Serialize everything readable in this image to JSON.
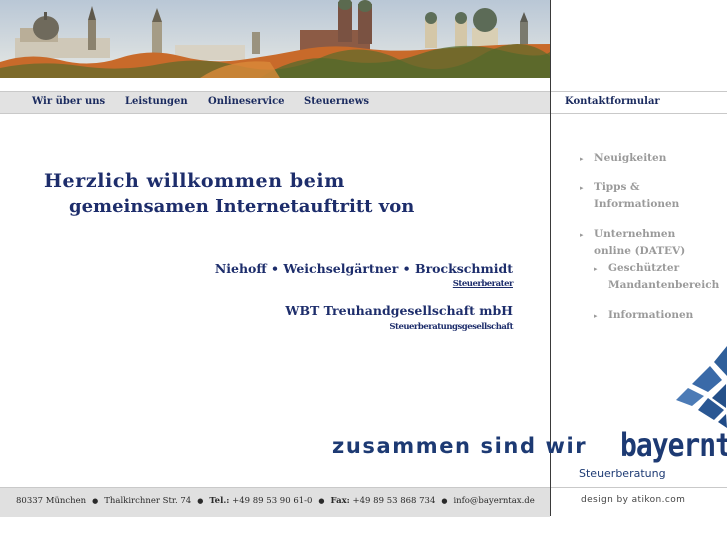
{
  "nav": {
    "items": [
      "Wir über uns",
      "Leistungen",
      "Onlineservice",
      "Steuernews"
    ],
    "contact": "Kontaktformular"
  },
  "welcome": {
    "line1": "Herzlich willkommen beim",
    "line2": "gemeinsamen Internetauftritt von"
  },
  "firms": [
    {
      "name": "Niehoff • Weichselgärtner • Brockschmidt",
      "type": "Steuerberater"
    },
    {
      "name": "WBT Treuhandgesellschaft mbH",
      "type": "Steuerberatungsgesellschaft"
    }
  ],
  "sidebar": {
    "bullet_icon": "triangle-bullet-icon",
    "items": [
      {
        "label": "Neuigkeiten"
      },
      {
        "label": "Tipps & Informationen"
      },
      {
        "label": "Unternehmen online (DATEV)"
      },
      {
        "label": "Geschützter Mandantenbereich"
      },
      {
        "label": "Informationen"
      }
    ]
  },
  "slogan": "zusammen sind wir",
  "logo": {
    "text": "bayerntax",
    "sub": "Steuerberatung"
  },
  "footer": {
    "city": "80337 München",
    "street": "Thalkirchner Str. 74",
    "tel_label": "Tel.:",
    "tel": "+49 89 53 90 61-0",
    "fax_label": "Fax:",
    "fax": "+49 89 53 868 734",
    "email": "info@bayerntax.de",
    "credit": "design by atikon.com"
  },
  "colors": {
    "navy": "#1d2d6b",
    "grey_link": "#9a9a9a",
    "bar_bg": "#e2e2e2"
  }
}
